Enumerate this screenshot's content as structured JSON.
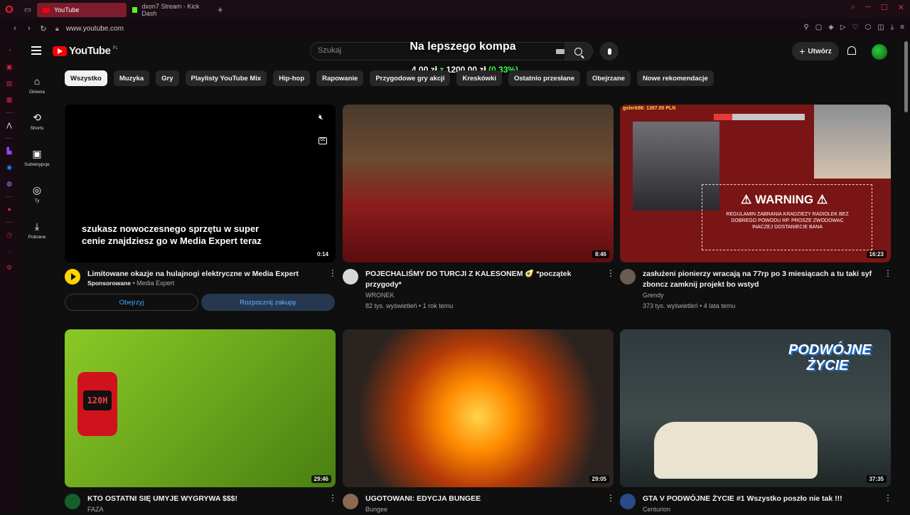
{
  "browser": {
    "tabs": [
      {
        "label": "YouTube",
        "active": true
      },
      {
        "label": "dxon7 Stream - Kick Dash",
        "active": false
      }
    ],
    "url": "www.youtube.com"
  },
  "opera_sidebar": {
    "icons": [
      "history-icon",
      "bag-icon",
      "wallet-icon",
      "news-icon",
      "aria-icon",
      "twitch-icon",
      "messenger-icon",
      "discord-icon",
      "record-icon",
      "clock-icon",
      "chat-icon",
      "settings-icon"
    ]
  },
  "header": {
    "logo_text": "YouTube",
    "region": "PL",
    "search_placeholder": "Szukaj",
    "create_label": "Utwórz"
  },
  "overlay": {
    "title": "Na lepszego kompa",
    "current": "4,00 zł",
    "separator": "z",
    "goal": "1200,00 zł",
    "percent": "(0.33%)",
    "accent": "#3bff3b"
  },
  "chips": [
    "Wszystko",
    "Muzyka",
    "Gry",
    "Playlisty YouTube Mix",
    "Hip-hop",
    "Rapowanie",
    "Przygodowe gry akcji",
    "Kreskówki",
    "Ostatnio przesłane",
    "Obejrzane",
    "Nowe rekomendacje"
  ],
  "sidebar": [
    {
      "label": "Główna",
      "icon": "home-icon"
    },
    {
      "label": "Shorts",
      "icon": "shorts-icon"
    },
    {
      "label": "Subskrypcje",
      "icon": "subscriptions-icon"
    },
    {
      "label": "Ty",
      "icon": "user-icon"
    },
    {
      "label": "Pobrane",
      "icon": "download-icon"
    }
  ],
  "ad": {
    "caption_line1": "szukasz nowoczesnego sprzętu w super",
    "caption_line2": "cenie znajdziesz go w Media Expert teraz",
    "duration": "0:14",
    "title": "Limitowane okazje na hulajnogi elektryczne w Media Expert",
    "sponsored": "Sponsorowane",
    "advertiser": "Media Expert",
    "watch_label": "Obejrzyj",
    "shop_label": "Rozpocznij zakupy"
  },
  "videos": [
    {
      "title": "POJECHALIŚMY DO TURCJI Z KALESONEM 🥑 *początek przygody*",
      "channel": "WRONEK",
      "stats": "82 tys. wyświetleń • 1 rok temu",
      "duration": "8:46"
    },
    {
      "title": "zasłużeni pionierzy wracają na 77rp po 3 miesiącach a tu taki syf zboncz zamknij projekt bo wstyd",
      "channel": "Grendy",
      "stats": "373 tys. wyświetleń • 4 lata temu",
      "duration": "16:23"
    },
    {
      "title": "KTO OSTATNI SIĘ UMYJE WYGRYWA $$$!",
      "channel": "FAZA",
      "stats": "",
      "duration": "29:46"
    },
    {
      "title": "UGOTOWANI: EDYCJA BUNGEE",
      "channel": "Bungee",
      "stats": "",
      "duration": "29:05"
    },
    {
      "title": "GTA V PODWÓJNE ŻYCIE #1 Wszystko poszło nie tak !!!",
      "channel": "Centurion",
      "stats": "",
      "duration": "37:35"
    }
  ],
  "thumb_text": {
    "warning_top": "golerk98: 1397.00 PLN",
    "warning_big": "⚠ WARNING ⚠",
    "warning_line1": "REGULAMIN ZABRANIA KRADZIEZY RADIOLEK BEZ",
    "warning_line2": "DOBREGO POWODU RP. PROSZE ZWODOWAC",
    "warning_line3": "INACZEJ DOSTANIECIE BANA",
    "watch_face": "120H",
    "gta_line1": "PODWÓJNE",
    "gta_line2": "ŻYCIE"
  }
}
